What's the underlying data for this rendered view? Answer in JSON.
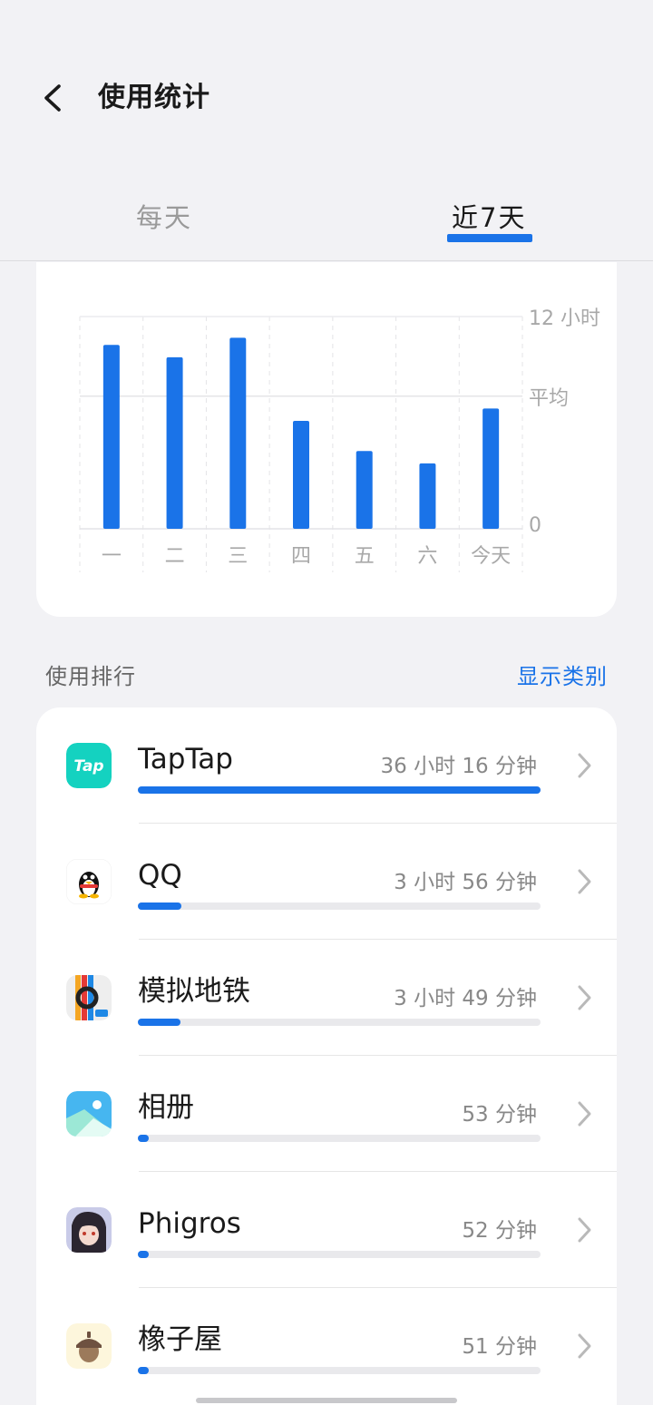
{
  "header": {
    "title": "使用统计",
    "tabs": [
      "每天",
      "近7天"
    ],
    "active_tab": "近7天"
  },
  "chart_data": {
    "type": "bar",
    "categories": [
      "一",
      "二",
      "三",
      "四",
      "五",
      "六",
      "今天"
    ],
    "values": [
      10.4,
      9.7,
      10.8,
      6.1,
      4.4,
      3.7,
      6.8
    ],
    "unit": "小时",
    "ylim": [
      0,
      12
    ],
    "y_tick_labels": [
      "12 小时",
      "平均",
      "0"
    ],
    "average_line_value": 7.5,
    "color": "#1a73e8",
    "grid": true
  },
  "ranking": {
    "title": "使用排行",
    "action_label": "显示类别",
    "apps": [
      {
        "name": "TapTap",
        "time": "36 小时 16 分钟",
        "minutes": 2176,
        "icon": "taptap-icon"
      },
      {
        "name": "QQ",
        "time": "3 小时 56 分钟",
        "minutes": 236,
        "icon": "qq-penguin-icon"
      },
      {
        "name": "模拟地铁",
        "time": "3 小时 49 分钟",
        "minutes": 229,
        "icon": "metro-icon"
      },
      {
        "name": "相册",
        "time": "53 分钟",
        "minutes": 53,
        "icon": "gallery-icon"
      },
      {
        "name": "Phigros",
        "time": "52 分钟",
        "minutes": 52,
        "icon": "phigros-icon"
      },
      {
        "name": "橡子屋",
        "time": "51 分钟",
        "minutes": 51,
        "icon": "acorn-icon"
      }
    ]
  },
  "colors": {
    "accent": "#1a73e8",
    "background": "#f2f2f5",
    "card": "#ffffff"
  }
}
